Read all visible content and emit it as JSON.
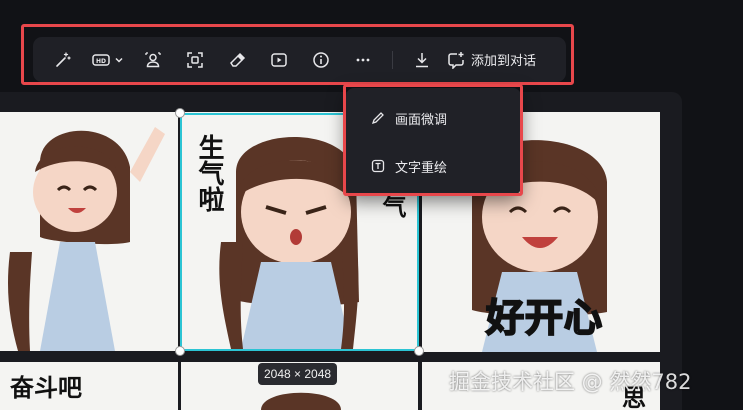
{
  "toolbar": {
    "items": [
      {
        "name": "magic-wand",
        "label": ""
      },
      {
        "name": "hd-upscale",
        "label": "HD"
      },
      {
        "name": "portrait-cutout",
        "label": ""
      },
      {
        "name": "focus-crop",
        "label": ""
      },
      {
        "name": "eraser",
        "label": ""
      },
      {
        "name": "play-video",
        "label": ""
      },
      {
        "name": "info",
        "label": ""
      },
      {
        "name": "more",
        "label": "···"
      },
      {
        "name": "download",
        "label": ""
      }
    ],
    "add_to_chat_label": "添加到对话"
  },
  "dropdown": {
    "items": [
      {
        "label": "画面微调",
        "icon": "pen-icon"
      },
      {
        "label": "文字重绘",
        "icon": "text-box-icon"
      }
    ]
  },
  "canvas": {
    "tiles": [
      {
        "caption": ""
      },
      {
        "caption": "生气啦"
      },
      {
        "caption": "好开心"
      },
      {
        "caption": "奋斗吧"
      },
      {
        "caption": ""
      },
      {
        "caption": "思"
      }
    ],
    "tile2_side_caption": "生气啦",
    "selection_size": "2048 × 2048"
  },
  "watermark": "掘金技术社区 @ 然然782",
  "colors": {
    "highlight": "#e8474b",
    "selection": "#2cc4d4",
    "toolbar_bg": "#1f2026"
  }
}
